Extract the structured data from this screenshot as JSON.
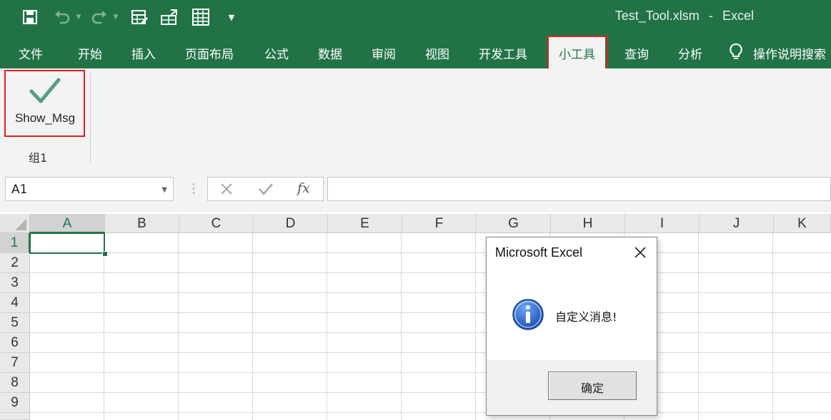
{
  "window": {
    "file_name": "Test_Tool.xlsm",
    "separator": "-",
    "app_name": "Excel"
  },
  "quick_access": {
    "icons": [
      "save-icon",
      "undo-icon",
      "redo-icon",
      "form-icon",
      "share-icon",
      "table-icon",
      "customize-icon"
    ]
  },
  "tabs": [
    {
      "label": "文件"
    },
    {
      "label": "开始"
    },
    {
      "label": "插入"
    },
    {
      "label": "页面布局"
    },
    {
      "label": "公式"
    },
    {
      "label": "数据"
    },
    {
      "label": "审阅"
    },
    {
      "label": "视图"
    },
    {
      "label": "开发工具"
    },
    {
      "label": "小工具",
      "active": true
    },
    {
      "label": "查询"
    },
    {
      "label": "分析"
    }
  ],
  "tell_me": {
    "icon": "lightbulb-icon",
    "label": "操作说明搜索"
  },
  "ribbon": {
    "button_label": "Show_Msg",
    "button_icon": "checkmark-icon",
    "group_label": "组1"
  },
  "formula_bar": {
    "name_box": "A1",
    "formula": ""
  },
  "grid": {
    "columns": [
      "A",
      "B",
      "C",
      "D",
      "E",
      "F",
      "G",
      "H",
      "I",
      "J",
      "K"
    ],
    "rows": [
      "1",
      "2",
      "3",
      "4",
      "5",
      "6",
      "7",
      "8",
      "9"
    ],
    "active_cell": "A1"
  },
  "dialog": {
    "title": "Microsoft Excel",
    "message": "自定义消息!",
    "icon": "info-icon",
    "ok_label": "确定"
  },
  "colors": {
    "excel_green": "#217346",
    "highlight_red": "#e02020"
  }
}
